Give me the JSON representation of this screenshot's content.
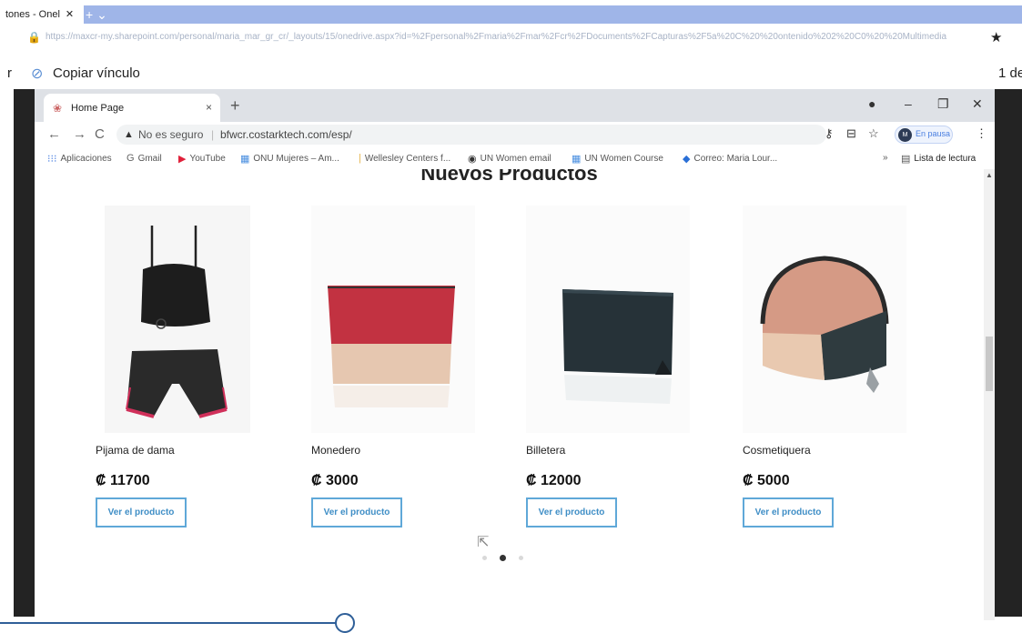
{
  "outer_browser": {
    "tab_label": "tones - Onel",
    "tab_close": "✕",
    "new_tab": "+ ⌄",
    "lock_icon": "🔒",
    "url": "https://maxcr-my.sharepoint.com/personal/maria_mar_gr_cr/_layouts/15/onedrive.aspx?id=%2Fpersonal%2Fmaria%2Fmar%2Fcr%2FDocuments%2FCapturas%2F5a%20C%20%20ontenido%202%20C0%20%20Multimedia",
    "star_icon": "★"
  },
  "outer_toolbar": {
    "left_fragment": "r",
    "link_icon": "⊘",
    "copy_link": "Copiar vínculo",
    "page_fragment": "1 de"
  },
  "inner_browser": {
    "favicon": "❀",
    "tab_title": "Home Page",
    "tab_close": "×",
    "new_tab": "+",
    "window_controls": {
      "record": "●",
      "minimize": "–",
      "restore": "❐",
      "close": "✕"
    },
    "nav": {
      "back": "←",
      "forward": "→",
      "reload": "C"
    },
    "omnibox": {
      "warn_icon": "▲",
      "insecure_text": "No es seguro",
      "separator": "|",
      "host": "bfwcr.costarktech.com/esp/"
    },
    "right_icons": {
      "key": "⚷",
      "cast": "⊟",
      "star": "☆",
      "menu": "⋮"
    },
    "profile": {
      "initials": "M",
      "status": "En pausa"
    },
    "bookmarks": [
      {
        "icon": "⁝⁝⁝",
        "label": "Aplicaciones"
      },
      {
        "icon": "G",
        "label": "Gmail"
      },
      {
        "icon": "▶",
        "label": "YouTube"
      },
      {
        "icon": "▦",
        "label": "ONU Mujeres – Am..."
      },
      {
        "icon": "|",
        "label": "Wellesley Centers f..."
      },
      {
        "icon": "◉",
        "label": "UN Women email"
      },
      {
        "icon": "▦",
        "label": "UN Women Course"
      },
      {
        "icon": "◆",
        "label": "Correo: Maria Lour..."
      }
    ],
    "more_bookmarks": "»",
    "reading_list": {
      "icon": "▤",
      "label": "Lista de lectura"
    },
    "scroll_up": "▲"
  },
  "page": {
    "heading": "Nuevos Productos",
    "products": [
      {
        "name": "Pijama de dama",
        "price": "₡ 11700",
        "button": "Ver el producto"
      },
      {
        "name": "Monedero",
        "price": "₡ 3000",
        "button": "Ver el producto"
      },
      {
        "name": "Billetera",
        "price": "₡ 12000",
        "button": "Ver el producto"
      },
      {
        "name": "Cosmetiquera",
        "price": "₡ 5000",
        "button": "Ver el producto"
      }
    ],
    "carousel": {
      "active_index": 1,
      "count": 3
    },
    "cursor_icon": "⇱"
  },
  "video_progress_fraction": 0.34,
  "colors": {
    "accent": "#5fa8d8",
    "outer_tab_strip": "#9fb5e8",
    "side_bars": "#232323"
  }
}
